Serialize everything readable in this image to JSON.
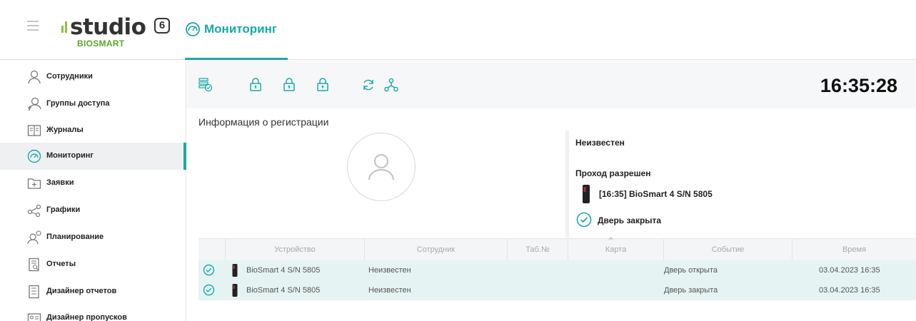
{
  "app": {
    "logo_text": "studio",
    "logo_version": "6",
    "logo_sub": "BIOSMART"
  },
  "header": {
    "page_title": "Мониторинг",
    "accent": "#1aa9a6"
  },
  "sidebar": {
    "items": [
      {
        "label": "Сотрудники",
        "icon": "user-icon"
      },
      {
        "label": "Группы доступа",
        "icon": "group-icon"
      },
      {
        "label": "Журналы",
        "icon": "journal-icon"
      },
      {
        "label": "Мониторинг",
        "icon": "monitoring-icon",
        "active": true
      },
      {
        "label": "Заявки",
        "icon": "folder-plus-icon"
      },
      {
        "label": "Графики",
        "icon": "schedule-icon"
      },
      {
        "label": "Планирование",
        "icon": "planning-icon"
      },
      {
        "label": "Отчеты",
        "icon": "report-icon"
      },
      {
        "label": "Дизайнер отчетов",
        "icon": "report-designer-icon"
      },
      {
        "label": "Дизайнер пропусков",
        "icon": "pass-designer-icon"
      }
    ]
  },
  "toolbar": {
    "icons": [
      "device-list-icon",
      "lock-icon",
      "lock-icon",
      "lock-icon",
      "refresh-icon",
      "network-icon"
    ],
    "clock": "16:35:28"
  },
  "registration": {
    "title": "Информация о регистрации",
    "employee": "Неизвестен",
    "status": "Проход разрешен",
    "device_event": "[16:35] BioSmart 4 S/N 5805",
    "door_state": "Дверь закрыта"
  },
  "table": {
    "columns": [
      "Устройство",
      "Сотрудник",
      "Таб.№",
      "Карта",
      "Событие",
      "Время"
    ],
    "sort_indicator": "^",
    "rows": [
      {
        "device": "BioSmart 4 S/N 5805",
        "employee": "Неизвестен",
        "tab": "",
        "card": "",
        "event": "Дверь открыта",
        "time": "03.04.2023 16:35"
      },
      {
        "device": "BioSmart 4 S/N 5805",
        "employee": "Неизвестен",
        "tab": "",
        "card": "",
        "event": "Дверь закрыта",
        "time": "03.04.2023 16:35"
      }
    ]
  }
}
